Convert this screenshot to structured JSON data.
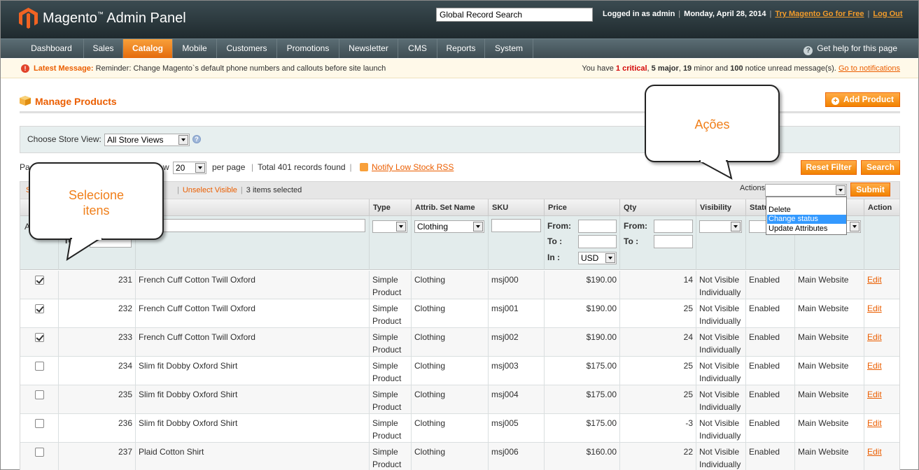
{
  "header": {
    "brand": "Magento",
    "brand_tm": "™",
    "brand_suffix": " Admin Panel",
    "search_value": "Global Record Search",
    "logged_in": "Logged in as admin",
    "date": "Monday, April 28, 2014",
    "try_link": "Try Magento Go for Free",
    "logout_link": "Log Out",
    "separator": "|"
  },
  "nav": {
    "items": [
      "Dashboard",
      "Sales",
      "Catalog",
      "Mobile",
      "Customers",
      "Promotions",
      "Newsletter",
      "CMS",
      "Reports",
      "System"
    ],
    "active": "Catalog",
    "help": "Get help for this page"
  },
  "message": {
    "label": "Latest Message:",
    "text": " Reminder: Change Magento`s default phone numbers and callouts before site launch",
    "summary_prefix": "You have ",
    "critical_count": "1 critical",
    "sep1": ", ",
    "major_count": "5 major",
    "sep2": ", ",
    "minor_count": "19",
    "minor_text": " minor and ",
    "notice_count": "100",
    "notice_text": " notice unread message(s). ",
    "link": "Go to notifications"
  },
  "page": {
    "title": "Manage Products",
    "add_button": "Add Product",
    "store_view_label": "Choose Store View:",
    "store_view_value": "All Store Views"
  },
  "pager": {
    "page_prefix": "Pa",
    "view_suffix": "w",
    "per_page_value": "20",
    "per_page_label": "per page",
    "total": "Total 401 records found",
    "rss_link": "Notify Low Stock RSS",
    "reset_filter": "Reset Filter",
    "search": "Search"
  },
  "massaction": {
    "select_prefix": "S",
    "unselect_visible": "Unselect Visible",
    "selected": "3 items selected",
    "actions_label": "Actions",
    "submit": "Submit",
    "options": [
      "Delete",
      "Change status",
      "Update Attributes"
    ],
    "highlighted": "Change status"
  },
  "grid": {
    "columns": [
      "Type",
      "Attrib. Set Name",
      "SKU",
      "Price",
      "Qty",
      "Visibility",
      "Statu",
      "Action"
    ],
    "filters": {
      "id_from_prefix": "A",
      "id_to_label": "To",
      "attrib_set": "Clothing",
      "price_from": "From:",
      "price_to": "To :",
      "price_in": "In :",
      "currency": "USD",
      "qty_from": "From:",
      "qty_to": "To :"
    },
    "rows": [
      {
        "checked": true,
        "id": "231",
        "name": "French Cuff Cotton Twill Oxford",
        "type_1": "Simple",
        "type_2": "Product",
        "set": "Clothing",
        "sku": "msj000",
        "price": "$190.00",
        "qty": "14",
        "vis_1": "Not Visible",
        "vis_2": "Individually",
        "status": "Enabled",
        "website": "Main Website",
        "action": "Edit"
      },
      {
        "checked": true,
        "id": "232",
        "name": "French Cuff Cotton Twill Oxford",
        "type_1": "Simple",
        "type_2": "Product",
        "set": "Clothing",
        "sku": "msj001",
        "price": "$190.00",
        "qty": "25",
        "vis_1": "Not Visible",
        "vis_2": "Individually",
        "status": "Enabled",
        "website": "Main Website",
        "action": "Edit"
      },
      {
        "checked": true,
        "id": "233",
        "name": "French Cuff Cotton Twill Oxford",
        "type_1": "Simple",
        "type_2": "Product",
        "set": "Clothing",
        "sku": "msj002",
        "price": "$190.00",
        "qty": "24",
        "vis_1": "Not Visible",
        "vis_2": "Individually",
        "status": "Enabled",
        "website": "Main Website",
        "action": "Edit"
      },
      {
        "checked": false,
        "id": "234",
        "name": "Slim fit Dobby Oxford Shirt",
        "type_1": "Simple",
        "type_2": "Product",
        "set": "Clothing",
        "sku": "msj003",
        "price": "$175.00",
        "qty": "25",
        "vis_1": "Not Visible",
        "vis_2": "Individually",
        "status": "Enabled",
        "website": "Main Website",
        "action": "Edit"
      },
      {
        "checked": false,
        "id": "235",
        "name": "Slim fit Dobby Oxford Shirt",
        "type_1": "Simple",
        "type_2": "Product",
        "set": "Clothing",
        "sku": "msj004",
        "price": "$175.00",
        "qty": "25",
        "vis_1": "Not Visible",
        "vis_2": "Individually",
        "status": "Enabled",
        "website": "Main Website",
        "action": "Edit"
      },
      {
        "checked": false,
        "id": "236",
        "name": "Slim fit Dobby Oxford Shirt",
        "type_1": "Simple",
        "type_2": "Product",
        "set": "Clothing",
        "sku": "msj005",
        "price": "$175.00",
        "qty": "-3",
        "vis_1": "Not Visible",
        "vis_2": "Individually",
        "status": "Enabled",
        "website": "Main Website",
        "action": "Edit"
      },
      {
        "checked": false,
        "id": "237",
        "name": "Plaid Cotton Shirt",
        "type_1": "Simple",
        "type_2": "Product",
        "set": "Clothing",
        "sku": "msj006",
        "price": "$160.00",
        "qty": "22",
        "vis_1": "Not Visible",
        "vis_2": "Individually",
        "status": "Enabled",
        "website": "Main Website",
        "action": "Edit"
      }
    ]
  },
  "callouts": {
    "select_items_1": "Selecione",
    "select_items_2": "itens",
    "actions": "Ações"
  },
  "colors": {
    "accent": "#eb5e00",
    "header_bg": "#2d3a3f",
    "callout_text": "#f07f1a"
  }
}
